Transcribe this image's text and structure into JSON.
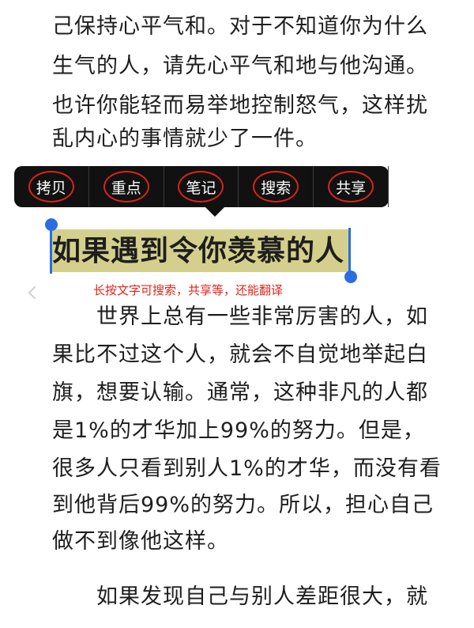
{
  "top_paragraph": {
    "lines": [
      "己保持心平气和。对于不知道你为什么",
      "生气的人，请先心平气和地与他沟通。",
      "也许你能轻而易举地控制怒气，这样扰",
      "乱内心的事情就少了一件。"
    ]
  },
  "popup_menu": {
    "items": [
      "拷贝",
      "重点",
      "笔记",
      "搜索",
      "共享"
    ]
  },
  "selected_heading": "如果遇到令你羡慕的人",
  "hint_annotation": "长按文字可搜索，共享等，还能翻译",
  "body_paragraph": {
    "lines": [
      "世界上总有一些非常厉害的人，如",
      "果比不过这个人，就会不自觉地举起白",
      "旗，想要认输。通常，这种非凡的人都",
      "是1%的才华加上99%的努力。但是，",
      "很多人只看到别人1%的才华，而没有看",
      "到他背后99%的努力。所以，担心自己",
      "做不到像他这样。"
    ]
  },
  "last_paragraph": {
    "lines": [
      "如果发现自己与别人差距很大，就"
    ]
  },
  "colors": {
    "selection_highlight": "#d4cf8c",
    "selection_handle": "#2a6edf",
    "popup_bg": "#111111",
    "annotation_red": "#d9241b"
  },
  "icons": {
    "page_back": "chevron-left-icon"
  }
}
